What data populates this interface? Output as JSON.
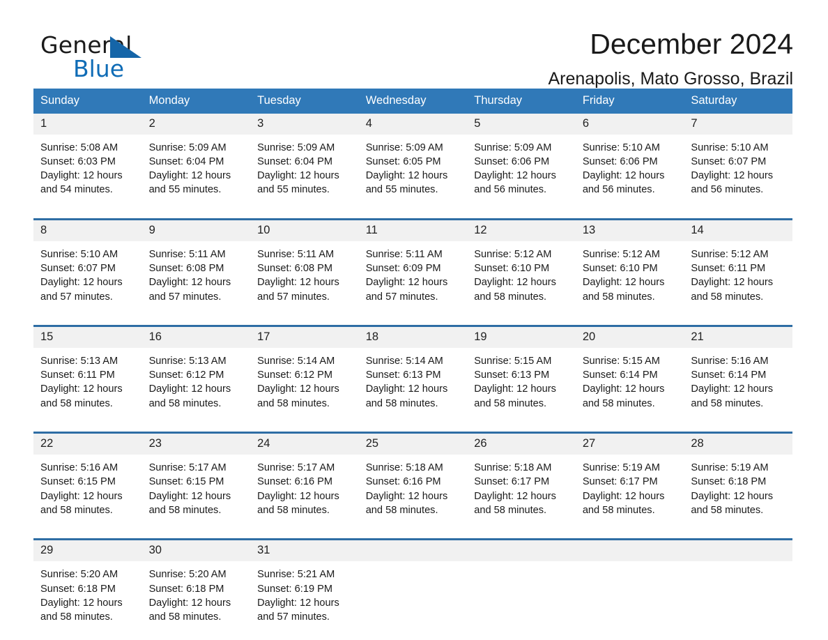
{
  "brand": {
    "name_part1": "General",
    "name_part2": "Blue",
    "accent_color": "#1565a8",
    "blue_text_color": "#0f6cb6"
  },
  "header": {
    "title": "December 2024",
    "location": "Arenapolis, Mato Grosso, Brazil"
  },
  "calendar": {
    "header_bg": "#3079b8",
    "row_border_color": "#2e6da4",
    "daynum_bg": "#f1f1f1",
    "weekday_headers": [
      "Sunday",
      "Monday",
      "Tuesday",
      "Wednesday",
      "Thursday",
      "Friday",
      "Saturday"
    ],
    "weeks": [
      [
        {
          "day": "1",
          "sunrise": "Sunrise: 5:08 AM",
          "sunset": "Sunset: 6:03 PM",
          "daylight_line1": "Daylight: 12 hours",
          "daylight_line2": "and 54 minutes."
        },
        {
          "day": "2",
          "sunrise": "Sunrise: 5:09 AM",
          "sunset": "Sunset: 6:04 PM",
          "daylight_line1": "Daylight: 12 hours",
          "daylight_line2": "and 55 minutes."
        },
        {
          "day": "3",
          "sunrise": "Sunrise: 5:09 AM",
          "sunset": "Sunset: 6:04 PM",
          "daylight_line1": "Daylight: 12 hours",
          "daylight_line2": "and 55 minutes."
        },
        {
          "day": "4",
          "sunrise": "Sunrise: 5:09 AM",
          "sunset": "Sunset: 6:05 PM",
          "daylight_line1": "Daylight: 12 hours",
          "daylight_line2": "and 55 minutes."
        },
        {
          "day": "5",
          "sunrise": "Sunrise: 5:09 AM",
          "sunset": "Sunset: 6:06 PM",
          "daylight_line1": "Daylight: 12 hours",
          "daylight_line2": "and 56 minutes."
        },
        {
          "day": "6",
          "sunrise": "Sunrise: 5:10 AM",
          "sunset": "Sunset: 6:06 PM",
          "daylight_line1": "Daylight: 12 hours",
          "daylight_line2": "and 56 minutes."
        },
        {
          "day": "7",
          "sunrise": "Sunrise: 5:10 AM",
          "sunset": "Sunset: 6:07 PM",
          "daylight_line1": "Daylight: 12 hours",
          "daylight_line2": "and 56 minutes."
        }
      ],
      [
        {
          "day": "8",
          "sunrise": "Sunrise: 5:10 AM",
          "sunset": "Sunset: 6:07 PM",
          "daylight_line1": "Daylight: 12 hours",
          "daylight_line2": "and 57 minutes."
        },
        {
          "day": "9",
          "sunrise": "Sunrise: 5:11 AM",
          "sunset": "Sunset: 6:08 PM",
          "daylight_line1": "Daylight: 12 hours",
          "daylight_line2": "and 57 minutes."
        },
        {
          "day": "10",
          "sunrise": "Sunrise: 5:11 AM",
          "sunset": "Sunset: 6:08 PM",
          "daylight_line1": "Daylight: 12 hours",
          "daylight_line2": "and 57 minutes."
        },
        {
          "day": "11",
          "sunrise": "Sunrise: 5:11 AM",
          "sunset": "Sunset: 6:09 PM",
          "daylight_line1": "Daylight: 12 hours",
          "daylight_line2": "and 57 minutes."
        },
        {
          "day": "12",
          "sunrise": "Sunrise: 5:12 AM",
          "sunset": "Sunset: 6:10 PM",
          "daylight_line1": "Daylight: 12 hours",
          "daylight_line2": "and 58 minutes."
        },
        {
          "day": "13",
          "sunrise": "Sunrise: 5:12 AM",
          "sunset": "Sunset: 6:10 PM",
          "daylight_line1": "Daylight: 12 hours",
          "daylight_line2": "and 58 minutes."
        },
        {
          "day": "14",
          "sunrise": "Sunrise: 5:12 AM",
          "sunset": "Sunset: 6:11 PM",
          "daylight_line1": "Daylight: 12 hours",
          "daylight_line2": "and 58 minutes."
        }
      ],
      [
        {
          "day": "15",
          "sunrise": "Sunrise: 5:13 AM",
          "sunset": "Sunset: 6:11 PM",
          "daylight_line1": "Daylight: 12 hours",
          "daylight_line2": "and 58 minutes."
        },
        {
          "day": "16",
          "sunrise": "Sunrise: 5:13 AM",
          "sunset": "Sunset: 6:12 PM",
          "daylight_line1": "Daylight: 12 hours",
          "daylight_line2": "and 58 minutes."
        },
        {
          "day": "17",
          "sunrise": "Sunrise: 5:14 AM",
          "sunset": "Sunset: 6:12 PM",
          "daylight_line1": "Daylight: 12 hours",
          "daylight_line2": "and 58 minutes."
        },
        {
          "day": "18",
          "sunrise": "Sunrise: 5:14 AM",
          "sunset": "Sunset: 6:13 PM",
          "daylight_line1": "Daylight: 12 hours",
          "daylight_line2": "and 58 minutes."
        },
        {
          "day": "19",
          "sunrise": "Sunrise: 5:15 AM",
          "sunset": "Sunset: 6:13 PM",
          "daylight_line1": "Daylight: 12 hours",
          "daylight_line2": "and 58 minutes."
        },
        {
          "day": "20",
          "sunrise": "Sunrise: 5:15 AM",
          "sunset": "Sunset: 6:14 PM",
          "daylight_line1": "Daylight: 12 hours",
          "daylight_line2": "and 58 minutes."
        },
        {
          "day": "21",
          "sunrise": "Sunrise: 5:16 AM",
          "sunset": "Sunset: 6:14 PM",
          "daylight_line1": "Daylight: 12 hours",
          "daylight_line2": "and 58 minutes."
        }
      ],
      [
        {
          "day": "22",
          "sunrise": "Sunrise: 5:16 AM",
          "sunset": "Sunset: 6:15 PM",
          "daylight_line1": "Daylight: 12 hours",
          "daylight_line2": "and 58 minutes."
        },
        {
          "day": "23",
          "sunrise": "Sunrise: 5:17 AM",
          "sunset": "Sunset: 6:15 PM",
          "daylight_line1": "Daylight: 12 hours",
          "daylight_line2": "and 58 minutes."
        },
        {
          "day": "24",
          "sunrise": "Sunrise: 5:17 AM",
          "sunset": "Sunset: 6:16 PM",
          "daylight_line1": "Daylight: 12 hours",
          "daylight_line2": "and 58 minutes."
        },
        {
          "day": "25",
          "sunrise": "Sunrise: 5:18 AM",
          "sunset": "Sunset: 6:16 PM",
          "daylight_line1": "Daylight: 12 hours",
          "daylight_line2": "and 58 minutes."
        },
        {
          "day": "26",
          "sunrise": "Sunrise: 5:18 AM",
          "sunset": "Sunset: 6:17 PM",
          "daylight_line1": "Daylight: 12 hours",
          "daylight_line2": "and 58 minutes."
        },
        {
          "day": "27",
          "sunrise": "Sunrise: 5:19 AM",
          "sunset": "Sunset: 6:17 PM",
          "daylight_line1": "Daylight: 12 hours",
          "daylight_line2": "and 58 minutes."
        },
        {
          "day": "28",
          "sunrise": "Sunrise: 5:19 AM",
          "sunset": "Sunset: 6:18 PM",
          "daylight_line1": "Daylight: 12 hours",
          "daylight_line2": "and 58 minutes."
        }
      ],
      [
        {
          "day": "29",
          "sunrise": "Sunrise: 5:20 AM",
          "sunset": "Sunset: 6:18 PM",
          "daylight_line1": "Daylight: 12 hours",
          "daylight_line2": "and 58 minutes."
        },
        {
          "day": "30",
          "sunrise": "Sunrise: 5:20 AM",
          "sunset": "Sunset: 6:18 PM",
          "daylight_line1": "Daylight: 12 hours",
          "daylight_line2": "and 58 minutes."
        },
        {
          "day": "31",
          "sunrise": "Sunrise: 5:21 AM",
          "sunset": "Sunset: 6:19 PM",
          "daylight_line1": "Daylight: 12 hours",
          "daylight_line2": "and 57 minutes."
        },
        {
          "day": "",
          "sunrise": "",
          "sunset": "",
          "daylight_line1": "",
          "daylight_line2": ""
        },
        {
          "day": "",
          "sunrise": "",
          "sunset": "",
          "daylight_line1": "",
          "daylight_line2": ""
        },
        {
          "day": "",
          "sunrise": "",
          "sunset": "",
          "daylight_line1": "",
          "daylight_line2": ""
        },
        {
          "day": "",
          "sunrise": "",
          "sunset": "",
          "daylight_line1": "",
          "daylight_line2": ""
        }
      ]
    ]
  }
}
